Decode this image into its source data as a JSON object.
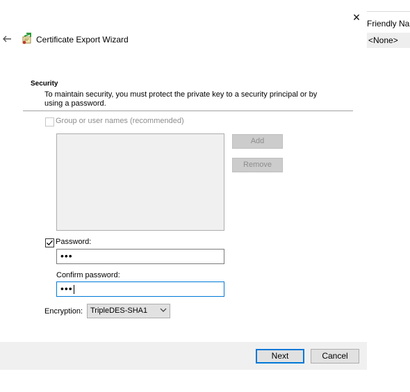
{
  "background": {
    "column_header": "Friendly Nam",
    "row_value": "<None>"
  },
  "window": {
    "title": "Certificate Export Wizard",
    "close_glyph": "×"
  },
  "security": {
    "title": "Security",
    "description": "To maintain security, you must protect the private key to a security principal or by using a password."
  },
  "group_option": {
    "label": "Group or user names (recommended)",
    "checked": false,
    "enabled": false
  },
  "buttons": {
    "add": "Add",
    "remove": "Remove",
    "next": "Next",
    "cancel": "Cancel"
  },
  "password_option": {
    "label": "Password:",
    "checked": true,
    "value": "•••"
  },
  "confirm_password": {
    "label": "Confirm password:",
    "value": "•••"
  },
  "encryption": {
    "label": "Encryption:",
    "selected": "TripleDES-SHA1"
  },
  "colors": {
    "accent": "#0078d7",
    "footer_bg": "#f0f0f0"
  }
}
